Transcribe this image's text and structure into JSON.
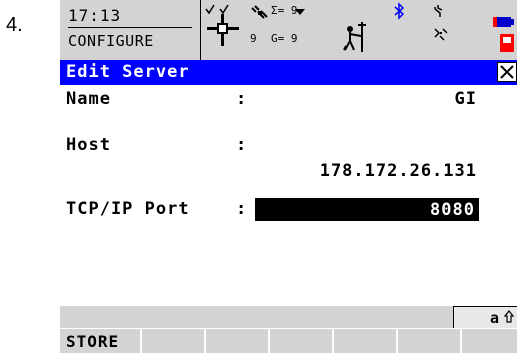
{
  "step_number": "4.",
  "status": {
    "time": "17:13",
    "mode": "CONFIGURE",
    "sats_sigma": "Σ= 9",
    "sats_gps": "9",
    "sats_glonass": "G= 9",
    "icons": [
      "crosshair-icon",
      "satellite-icon",
      "surveyor-icon",
      "bluetooth-icon",
      "antenna-icon",
      "battery-icon",
      "memory-card-icon"
    ]
  },
  "dialog": {
    "title": "Edit Server",
    "close_glyph": "X"
  },
  "form": {
    "name_label": "Name",
    "name_value": "GI",
    "host_label": "Host",
    "host_value": "178.172.26.131",
    "port_label": "TCP/IP Port",
    "port_value": "8080",
    "colon": ":"
  },
  "input_mode": "a",
  "softkeys": [
    "STORE",
    "",
    "",
    "",
    "",
    "",
    ""
  ],
  "colors": {
    "title_bar": "#0000ff",
    "status_bar": "#d3d3d3",
    "selected_field": "#000000",
    "battery": "#0000cc",
    "card": "#ff0000"
  }
}
